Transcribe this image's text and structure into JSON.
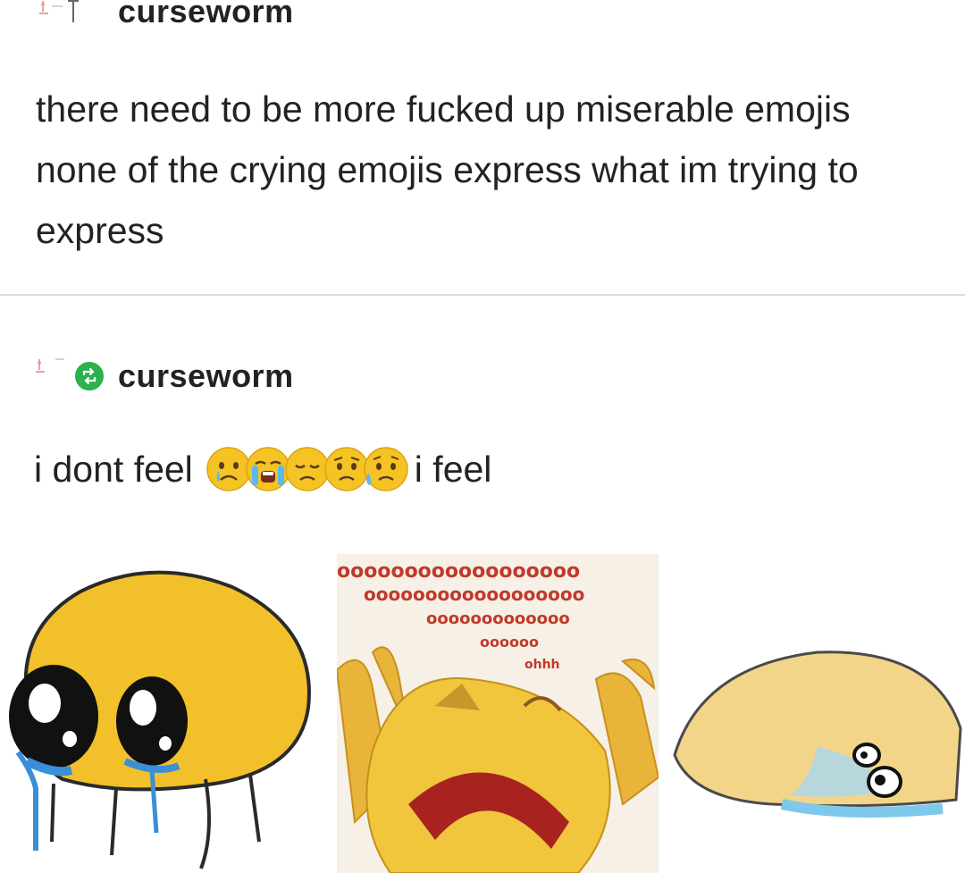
{
  "post1": {
    "username": "curseworm",
    "text": "there need to be more fucked up miserable emojis none of the crying emojis express what im trying to express"
  },
  "post2": {
    "username": "curseworm",
    "prefix": "i dont feel",
    "suffix": "i feel",
    "emojis": [
      "crying-face",
      "loudly-crying-face",
      "disappointed-face",
      "worried-face",
      "sad-but-relieved-face"
    ]
  },
  "colors": {
    "reblog_badge": "#2bb24c",
    "emoji_yellow": "#f5c323",
    "divider": "#dcdcdc"
  },
  "images": [
    {
      "name": "crying-blob-drawing"
    },
    {
      "name": "sobbing-emoji-collage",
      "caption_lines": [
        "oooooooooooooooooo",
        "oooooooooooooooooo",
        "ooooooooooooo",
        "oooooo",
        "ohhh"
      ]
    },
    {
      "name": "melted-blob-drawing"
    }
  ]
}
